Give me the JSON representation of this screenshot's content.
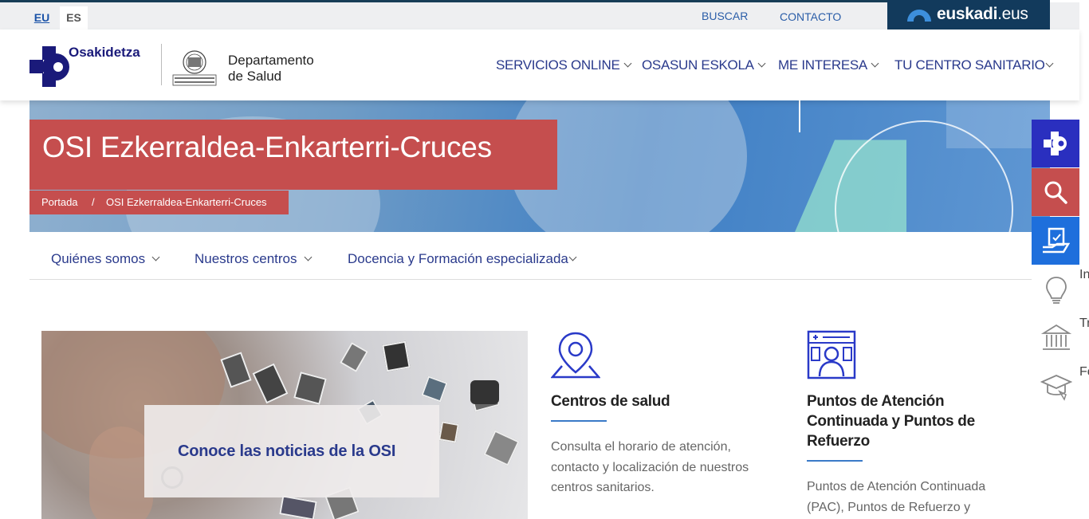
{
  "topbar": {
    "lang_eu": "EU",
    "lang_es": "ES",
    "search_label": "BUSCAR",
    "contact_label": "CONTACTO",
    "euskadi_bold": "euskadi",
    "euskadi_suffix": ".eus"
  },
  "header": {
    "org_name": "Osakidetza",
    "dept_line1": "Departamento",
    "dept_line2": "de Salud",
    "nav": [
      {
        "label": "SERVICIOS ONLINE"
      },
      {
        "label": "OSASUN ESKOLA"
      },
      {
        "label": "ME INTERESA"
      },
      {
        "label": "TU CENTRO SANITARIO"
      }
    ]
  },
  "hero": {
    "title": "OSI Ezkerraldea-Enkarterri-Cruces",
    "breadcrumb": {
      "home": "Portada",
      "separator": "/",
      "current": "OSI Ezkerraldea-Enkarterri-Cruces"
    }
  },
  "subnav": {
    "items": [
      {
        "label": "Quiénes somos"
      },
      {
        "label": "Nuestros centros"
      },
      {
        "label": "Docencia y Formación especializada"
      }
    ]
  },
  "news": {
    "label": "Conoce las noticias de la OSI"
  },
  "cards": [
    {
      "icon": "map-pin-icon",
      "title": "Centros de salud",
      "desc_lines": [
        "Consulta el horario de atención,",
        "contacto y localización de nuestros",
        "centros sanitarios."
      ]
    },
    {
      "icon": "doctor-board-icon",
      "title_lines": [
        "Puntos de Atención",
        "Continuada y Puntos de",
        "Refuerzo"
      ],
      "desc_lines": [
        "Puntos de Atención Continuada",
        "(PAC), Puntos de Refuerzo y"
      ]
    }
  ],
  "sidebar": {
    "labels": [
      "In",
      "Tr",
      "Fo"
    ]
  },
  "colors": {
    "brand_navy": "#1a1a7a",
    "accent_red": "#c54e4e",
    "link_blue": "#2a3a8c",
    "side_blue": "#2a2fbf",
    "side_lightblue": "#1e6fdc"
  }
}
